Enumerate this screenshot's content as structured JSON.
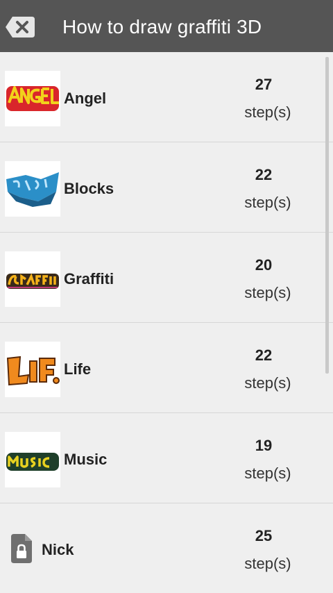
{
  "header": {
    "title": "How to draw graffiti 3D",
    "back_icon": "backspace-icon"
  },
  "items": [
    {
      "label": "Angel",
      "count": "27",
      "unit": "step(s)",
      "thumb": "angel-graffiti-thumbnail"
    },
    {
      "label": "Blocks",
      "count": "22",
      "unit": "step(s)",
      "thumb": "blocks-graffiti-thumbnail"
    },
    {
      "label": "Graffiti",
      "count": "20",
      "unit": "step(s)",
      "thumb": "graffiti-graffiti-thumbnail"
    },
    {
      "label": "Life",
      "count": "22",
      "unit": "step(s)",
      "thumb": "life-graffiti-thumbnail"
    },
    {
      "label": "Music",
      "count": "19",
      "unit": "step(s)",
      "thumb": "music-graffiti-thumbnail"
    },
    {
      "label": "Nick",
      "count": "25",
      "unit": "step(s)",
      "thumb": "locked-file-icon"
    }
  ],
  "colors": {
    "header_bg": "#555555",
    "list_bg": "#efefef",
    "divider": "#d6d6d6"
  }
}
